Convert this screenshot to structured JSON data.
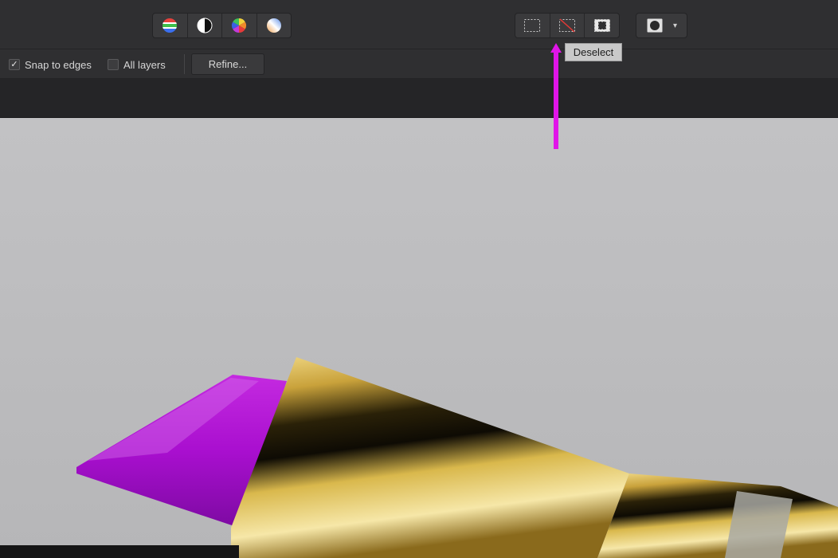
{
  "toolbar": {
    "adjustment_group": [
      {
        "name": "color-balance-icon"
      },
      {
        "name": "brightness-contrast-icon"
      },
      {
        "name": "hue-wheel-icon"
      },
      {
        "name": "gradient-map-icon"
      }
    ],
    "selection_group": [
      {
        "name": "select-all-icon"
      },
      {
        "name": "deselect-icon"
      },
      {
        "name": "invert-selection-icon"
      }
    ],
    "mask_dropdown": {
      "icon": "mask-icon",
      "caret": "▾"
    }
  },
  "context_bar": {
    "snap_to_edges": {
      "label": "Snap to edges",
      "checked": true,
      "mark": "✓"
    },
    "all_layers": {
      "label": "All layers",
      "checked": false
    },
    "refine_label": "Refine..."
  },
  "tooltip": {
    "text": "Deselect"
  },
  "colors": {
    "annotation_arrow": "#e015e8",
    "lipstick": "#b012d6",
    "canvas_bg": "#bdbdbf",
    "gold": "#d9b84c"
  }
}
